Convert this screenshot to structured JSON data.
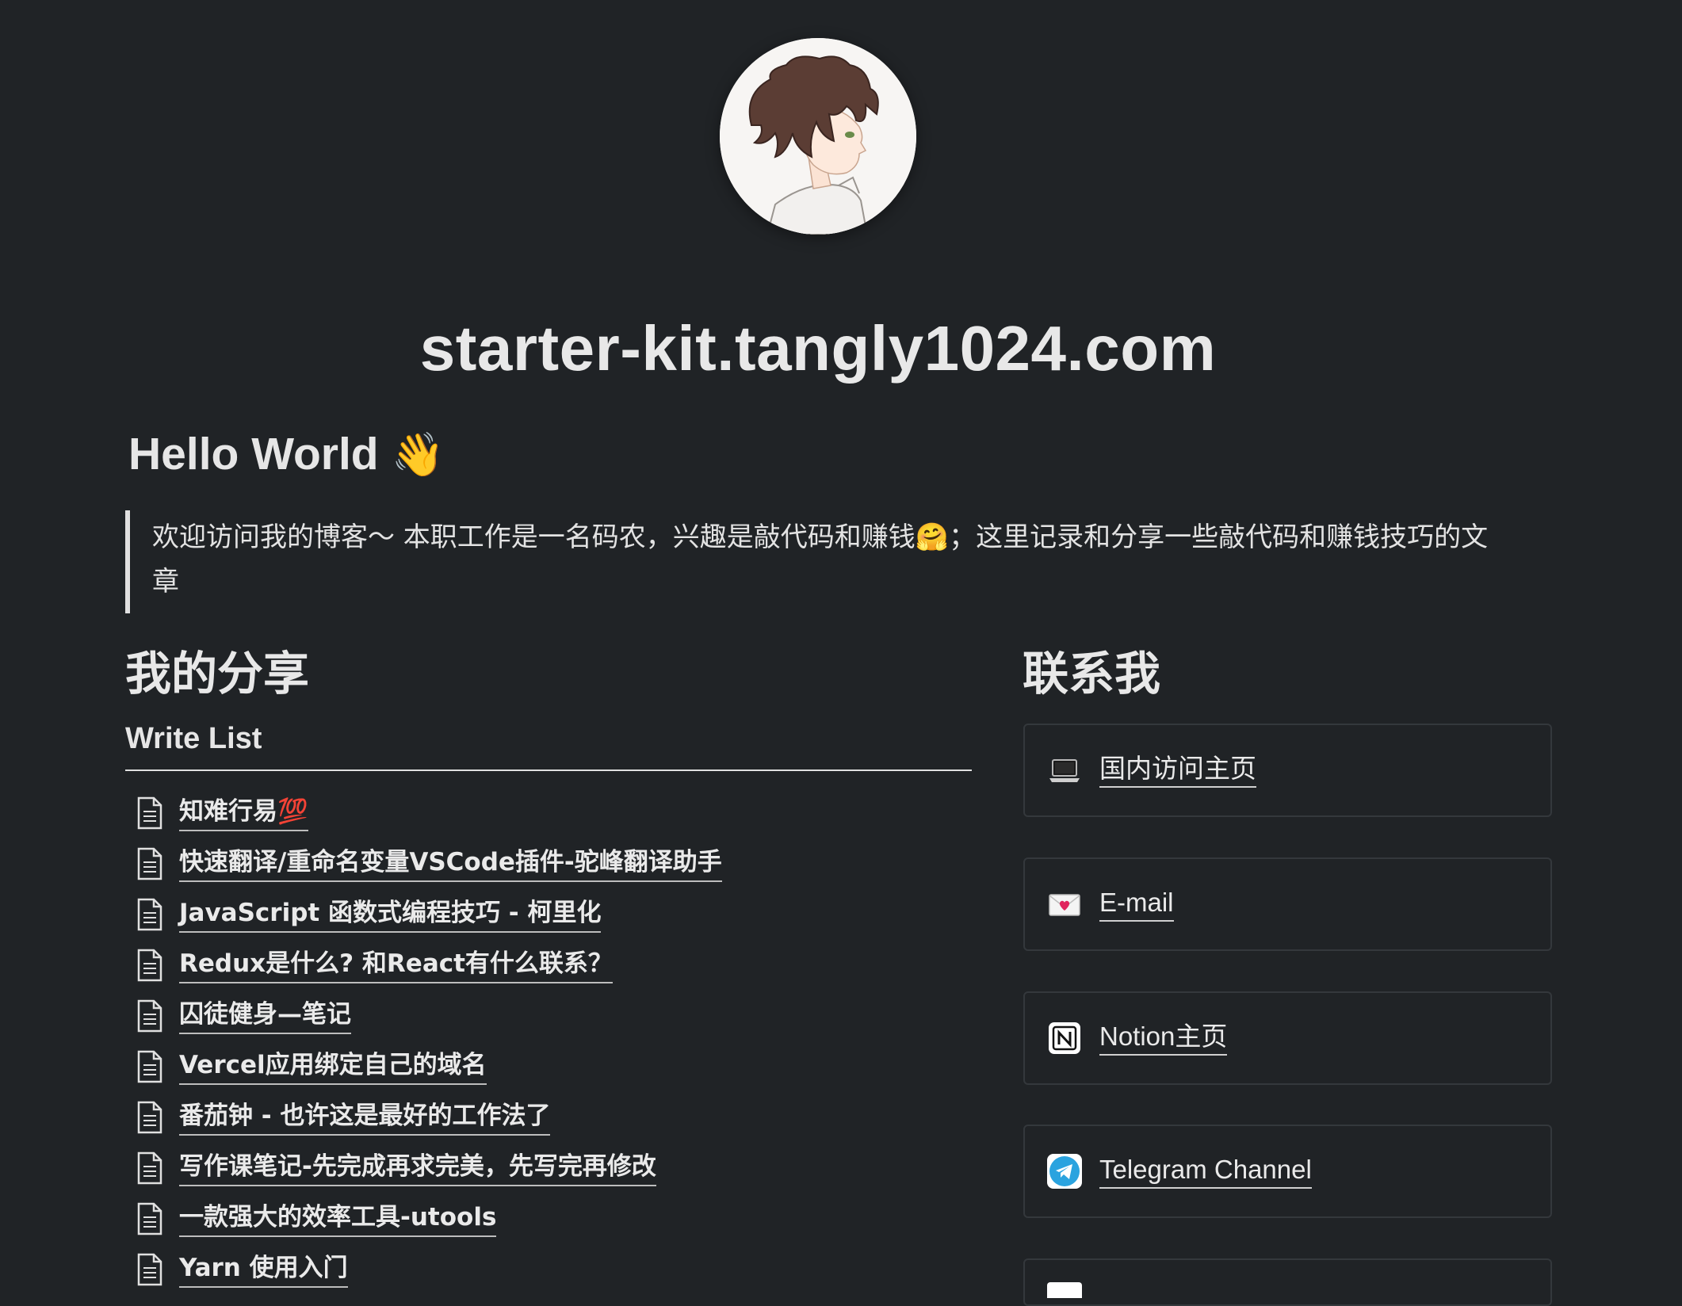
{
  "site": {
    "title": "starter-kit.tangly1024.com"
  },
  "avatar": {
    "icon": "anime-avatar"
  },
  "hero": {
    "heading": "Hello World",
    "wave_emoji": "👋",
    "quote_line1": "欢迎访问我的博客～ 本职工作是一名码农，兴趣是敲代码和赚钱🤗；这里记录和分享一些敲代码和赚钱技巧的文",
    "quote_line2": "章"
  },
  "share": {
    "title": "我的分享",
    "list_title": "Write List",
    "items": [
      {
        "label": "知难行易💯",
        "icon": "page-icon"
      },
      {
        "label": "快速翻译/重命名变量VSCode插件-驼峰翻译助手",
        "icon": "page-icon"
      },
      {
        "label": "JavaScript 函数式编程技巧 - 柯里化",
        "icon": "page-icon"
      },
      {
        "label": "Redux是什么? 和React有什么联系？",
        "icon": "page-icon"
      },
      {
        "label": "囚徒健身—笔记",
        "icon": "page-icon"
      },
      {
        "label": "Vercel应用绑定自己的域名",
        "icon": "page-icon"
      },
      {
        "label": "番茄钟 - 也许这是最好的工作法了",
        "icon": "page-icon"
      },
      {
        "label": "写作课笔记-先完成再求完美，先写完再修改",
        "icon": "page-icon"
      },
      {
        "label": "一款强大的效率工具-utools",
        "icon": "page-icon"
      },
      {
        "label": "Yarn 使用入门",
        "icon": "page-icon"
      }
    ]
  },
  "contact": {
    "title": "联系我",
    "cards": [
      {
        "label": "国内访问主页",
        "icon": "laptop-icon"
      },
      {
        "label": "E-mail",
        "icon": "love-letter-icon"
      },
      {
        "label": "Notion主页",
        "icon": "notion-icon"
      },
      {
        "label": "Telegram Channel",
        "icon": "telegram-icon"
      }
    ]
  },
  "colors": {
    "background": "#202326",
    "text": "#e6e6e6",
    "card_border": "#34383c",
    "telegram": "#2aa3df"
  }
}
